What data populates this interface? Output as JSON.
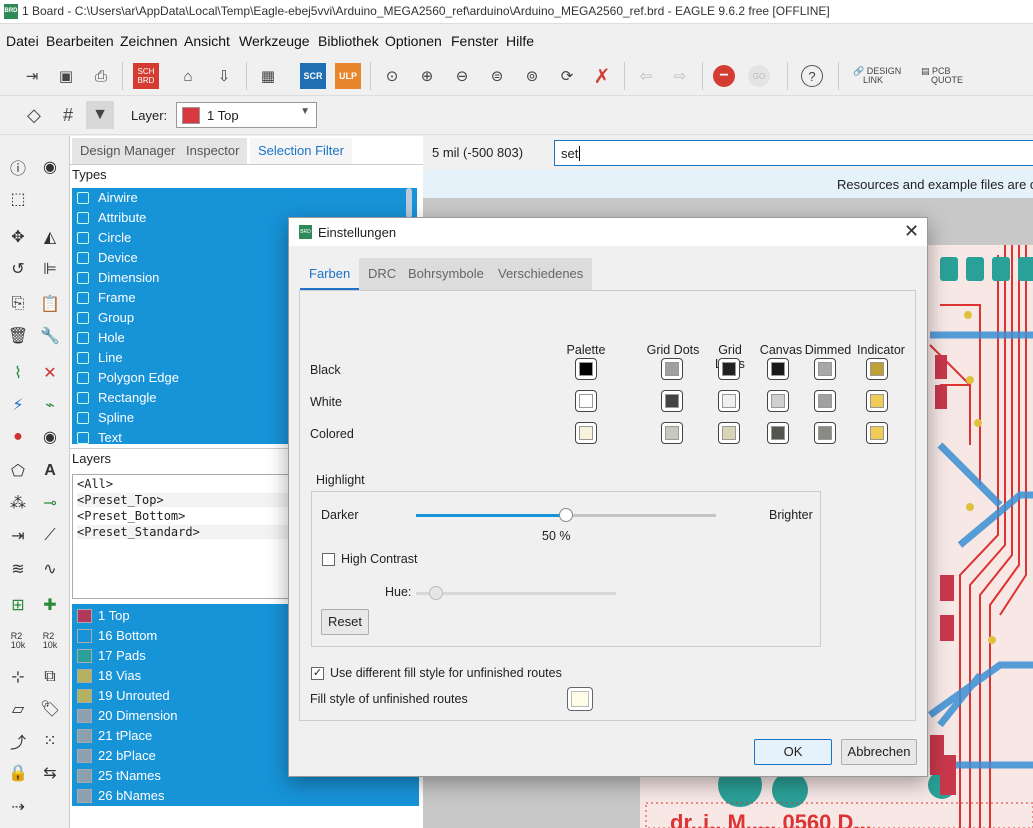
{
  "window": {
    "title": "1 Board - C:\\Users\\ar\\AppData\\Local\\Temp\\Eagle-ebej5vvi\\Arduino_MEGA2560_ref\\arduino\\Arduino_MEGA2560_ref.brd - EAGLE 9.6.2 free [OFFLINE]",
    "icon": "BRD"
  },
  "menu": [
    "Datei",
    "Bearbeiten",
    "Zeichnen",
    "Ansicht",
    "Werkzeuge",
    "Bibliothek",
    "Optionen",
    "Fenster",
    "Hilfe"
  ],
  "toolbar": {
    "sch_label": "SCH",
    "brd_label": "BRD",
    "scr_label": "SCR",
    "ulp_label": "ULP",
    "go_label": "GO",
    "design_link_1": "DESIGN",
    "design_link_2": "LINK",
    "pcb_quote_1": "PCB",
    "pcb_quote_2": "QUOTE"
  },
  "layer_bar": {
    "label": "Layer:",
    "selected": "1 Top",
    "selected_color": "#d8383f"
  },
  "panel": {
    "tabs": [
      "Design Manager",
      "Inspector",
      "Selection Filter"
    ],
    "active_tab": "Selection Filter",
    "types_header": "Types",
    "types": [
      "Airwire",
      "Attribute",
      "Circle",
      "Device",
      "Dimension",
      "Frame",
      "Group",
      "Hole",
      "Line",
      "Polygon Edge",
      "Rectangle",
      "Spline",
      "Text"
    ],
    "layers_header": "Layers",
    "presets": [
      "<All>",
      "<Preset_Top>",
      "<Preset_Bottom>",
      "<Preset_Standard>"
    ],
    "layers": [
      {
        "name": "1 Top",
        "color": "#b3395a"
      },
      {
        "name": "16 Bottom",
        "color": "#1793d8"
      },
      {
        "name": "17 Pads",
        "color": "#2aa198"
      },
      {
        "name": "18 Vias",
        "color": "#b5b060"
      },
      {
        "name": "19 Unrouted",
        "color": "#b5b060"
      },
      {
        "name": "20 Dimension",
        "color": "#8da0b0"
      },
      {
        "name": "21 tPlace",
        "color": "#8da0b0"
      },
      {
        "name": "22 bPlace",
        "color": "#8da0b0"
      },
      {
        "name": "25 tNames",
        "color": "#8da0b0"
      },
      {
        "name": "26 bNames",
        "color": "#8da0b0"
      }
    ]
  },
  "command": {
    "coords": "5 mil (-500 803)",
    "input": "set"
  },
  "info": {
    "text": "Resources and example files are ope"
  },
  "dialog": {
    "title": "Einstellungen",
    "icon": "BRD",
    "tabs": [
      "Farben",
      "DRC",
      "Bohrsymbole",
      "Verschiedenes"
    ],
    "columns": [
      "Palette",
      "Grid Dots",
      "Grid Lines",
      "Canvas",
      "Dimmed",
      "Indicator"
    ],
    "rows": [
      {
        "label": "Black",
        "colors": [
          "#000000",
          "#a0a0a0",
          "#222222",
          "#1a1a1a",
          "#a8a8a8",
          "#bfa133"
        ]
      },
      {
        "label": "White",
        "colors": [
          "#ffffff",
          "#444444",
          "#f0f0f0",
          "#d0d0d0",
          "#a0a0a0",
          "#f0cb58"
        ]
      },
      {
        "label": "Colored",
        "colors": [
          "#f8f3dc",
          "#c8c8c0",
          "#d8d4b8",
          "#555550",
          "#8a8a84",
          "#f0cb58"
        ]
      }
    ],
    "highlight": {
      "title": "Highlight",
      "darker": "Darker",
      "brighter": "Brighter",
      "value_label": "50 %",
      "value": 0.5,
      "high_contrast": "High Contrast",
      "high_contrast_checked": false,
      "hue_label": "Hue:",
      "hue": 0.04,
      "reset": "Reset"
    },
    "unfinished": {
      "checkbox_label": "Use different fill style for unfinished routes",
      "checked": true,
      "fill_label": "Fill style of unfinished routes"
    },
    "ok": "OK",
    "cancel": "Abbrechen"
  }
}
